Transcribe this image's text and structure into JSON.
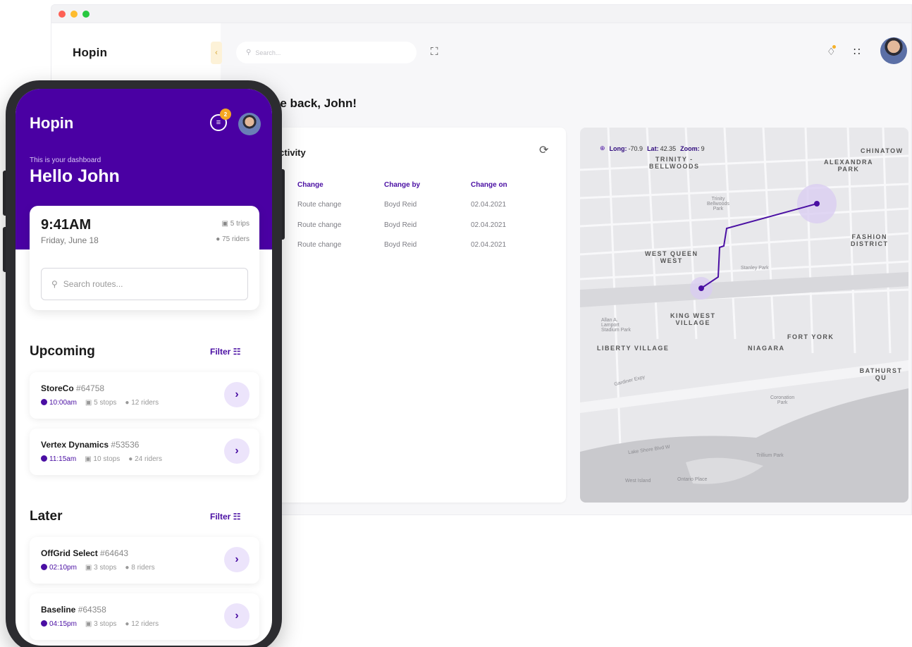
{
  "desktop": {
    "logo": "Hopin",
    "search_placeholder": "Search...",
    "welcome": "ne back, John!",
    "activity_title": "t activity",
    "table": {
      "headers": [
        "Change",
        "Change by",
        "Change on"
      ],
      "rows": [
        [
          "Route change",
          "Boyd Reid",
          "02.04.2021"
        ],
        [
          "Route change",
          "Boyd Reid",
          "02.04.2021"
        ],
        [
          "Route change",
          "Boyd Reid",
          "02.04.2021"
        ]
      ]
    },
    "map": {
      "long_label": "Long:",
      "long_value": "-70.9",
      "lat_label": "Lat:",
      "lat_value": "42.35",
      "zoom_label": "Zoom:",
      "zoom_value": "9",
      "labels": {
        "trinity": "TRINITY -\nBELLWOODS",
        "alexandra": "ALEXANDRA\nPARK",
        "chinatown": "CHINATOW",
        "fashion": "FASHION\nDISTRICT",
        "westqueen": "WEST QUEEN\nWEST",
        "kingwest": "KING WEST\nVILLAGE",
        "liberty": "LIBERTY VILLAGE",
        "niagara": "NIAGARA",
        "fortyork": "FORT YORK",
        "bathurst": "BATHURST QU",
        "stanley": "Stanley Park",
        "trinitypark": "Trinity\nBellwoods\nPark",
        "coronation": "Coronation\nPark",
        "trillium": "Trillium Park",
        "westisland": "West Island",
        "ontarioplace": "Ontario Place",
        "allan": "Allan A.\nLamport\nStadium Park",
        "gardiner": "Gardiner Expy",
        "lakeshore": "Lake Shore Blvd W"
      }
    }
  },
  "phone": {
    "logo": "Hopin",
    "notif_count": "2",
    "dash_sub": "This is your dashboard",
    "hello": "Hello John",
    "time": "9:41AM",
    "date": "Friday, June 18",
    "trips": "5 trips",
    "riders": "75 riders",
    "search_placeholder": "Search routes...",
    "upcoming_title": "Upcoming",
    "later_title": "Later",
    "filter_label": "Filter",
    "upcoming": [
      {
        "name": "StoreCo",
        "id": "#64758",
        "time": "10:00am",
        "stops": "5 stops",
        "riders": "12 riders"
      },
      {
        "name": "Vertex Dynamics",
        "id": "#53536",
        "time": "11:15am",
        "stops": "10 stops",
        "riders": "24 riders"
      }
    ],
    "later": [
      {
        "name": "OffGrid Select",
        "id": "#64643",
        "time": "02:10pm",
        "stops": "3 stops",
        "riders": "8 riders"
      },
      {
        "name": "Baseline",
        "id": "#64358",
        "time": "04:15pm",
        "stops": "3 stops",
        "riders": "12 riders"
      }
    ]
  },
  "colors": {
    "primary": "#4a00a3",
    "accent": "#f5a623",
    "light_purple": "#ece4fb"
  },
  "icons": [
    "search-icon",
    "expand-icon",
    "bell-icon",
    "apps-icon",
    "refresh-icon",
    "globe-icon",
    "notes-icon",
    "bus-icon",
    "rider-icon",
    "filter-icon",
    "chevron-right-icon",
    "chevron-left-icon"
  ]
}
